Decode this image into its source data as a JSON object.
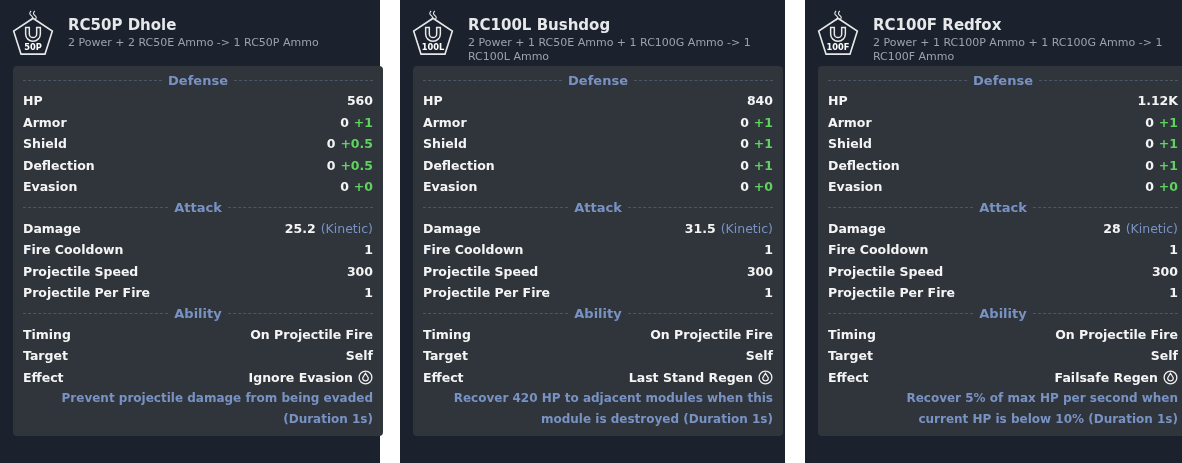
{
  "panels": [
    {
      "badge": "50P",
      "title": "RC50P Dhole",
      "recipe": "2 Power + 2 RC50E Ammo -> 1 RC50P Ammo",
      "sections": [
        {
          "heading": "Defense",
          "rows": [
            {
              "kind": "stat",
              "label": "HP",
              "value": "560"
            },
            {
              "kind": "stat",
              "label": "Armor",
              "value": "0",
              "bonus": "+1"
            },
            {
              "kind": "stat",
              "label": "Shield",
              "value": "0",
              "bonus": "+0.5"
            },
            {
              "kind": "stat",
              "label": "Deflection",
              "value": "0",
              "bonus": "+0.5"
            },
            {
              "kind": "stat",
              "label": "Evasion",
              "value": "0",
              "bonus": "+0"
            }
          ]
        },
        {
          "heading": "Attack",
          "rows": [
            {
              "kind": "stat",
              "label": "Damage",
              "value": "25.2",
              "note": "(Kinetic)"
            },
            {
              "kind": "stat",
              "label": "Fire Cooldown",
              "value": "1"
            },
            {
              "kind": "stat",
              "label": "Projectile Speed",
              "value": "300"
            },
            {
              "kind": "stat",
              "label": "Projectile Per Fire",
              "value": "1"
            }
          ]
        },
        {
          "heading": "Ability",
          "rows": [
            {
              "kind": "stat",
              "label": "Timing",
              "value": "On Projectile Fire"
            },
            {
              "kind": "stat",
              "label": "Target",
              "value": "Self"
            },
            {
              "kind": "effect",
              "label": "Effect",
              "value": "Ignore Evasion"
            }
          ],
          "description": "Prevent projectile damage from being evaded (Duration 1s)"
        }
      ]
    },
    {
      "badge": "100L",
      "title": "RC100L Bushdog",
      "recipe": "2 Power + 1 RC50E Ammo + 1 RC100G Ammo -> 1 RC100L Ammo",
      "sections": [
        {
          "heading": "Defense",
          "rows": [
            {
              "kind": "stat",
              "label": "HP",
              "value": "840"
            },
            {
              "kind": "stat",
              "label": "Armor",
              "value": "0",
              "bonus": "+1"
            },
            {
              "kind": "stat",
              "label": "Shield",
              "value": "0",
              "bonus": "+1"
            },
            {
              "kind": "stat",
              "label": "Deflection",
              "value": "0",
              "bonus": "+1"
            },
            {
              "kind": "stat",
              "label": "Evasion",
              "value": "0",
              "bonus": "+0"
            }
          ]
        },
        {
          "heading": "Attack",
          "rows": [
            {
              "kind": "stat",
              "label": "Damage",
              "value": "31.5",
              "note": "(Kinetic)"
            },
            {
              "kind": "stat",
              "label": "Fire Cooldown",
              "value": "1"
            },
            {
              "kind": "stat",
              "label": "Projectile Speed",
              "value": "300"
            },
            {
              "kind": "stat",
              "label": "Projectile Per Fire",
              "value": "1"
            }
          ]
        },
        {
          "heading": "Ability",
          "rows": [
            {
              "kind": "stat",
              "label": "Timing",
              "value": "On Projectile Fire"
            },
            {
              "kind": "stat",
              "label": "Target",
              "value": "Self"
            },
            {
              "kind": "effect",
              "label": "Effect",
              "value": "Last Stand Regen"
            }
          ],
          "description": "Recover 420 HP to adjacent modules when this module is destroyed (Duration 1s)"
        }
      ]
    },
    {
      "badge": "100F",
      "title": "RC100F Redfox",
      "recipe": "2 Power + 1 RC100P Ammo + 1 RC100G Ammo -> 1 RC100F Ammo",
      "sections": [
        {
          "heading": "Defense",
          "rows": [
            {
              "kind": "stat",
              "label": "HP",
              "value": "1.12K"
            },
            {
              "kind": "stat",
              "label": "Armor",
              "value": "0",
              "bonus": "+1"
            },
            {
              "kind": "stat",
              "label": "Shield",
              "value": "0",
              "bonus": "+1"
            },
            {
              "kind": "stat",
              "label": "Deflection",
              "value": "0",
              "bonus": "+1"
            },
            {
              "kind": "stat",
              "label": "Evasion",
              "value": "0",
              "bonus": "+0"
            }
          ]
        },
        {
          "heading": "Attack",
          "rows": [
            {
              "kind": "stat",
              "label": "Damage",
              "value": "28",
              "note": "(Kinetic)"
            },
            {
              "kind": "stat",
              "label": "Fire Cooldown",
              "value": "1"
            },
            {
              "kind": "stat",
              "label": "Projectile Speed",
              "value": "300"
            },
            {
              "kind": "stat",
              "label": "Projectile Per Fire",
              "value": "1"
            }
          ]
        },
        {
          "heading": "Ability",
          "rows": [
            {
              "kind": "stat",
              "label": "Timing",
              "value": "On Projectile Fire"
            },
            {
              "kind": "stat",
              "label": "Target",
              "value": "Self"
            },
            {
              "kind": "effect",
              "label": "Effect",
              "value": "Failsafe Regen"
            }
          ],
          "description": "Recover 5% of max HP per second when current HP is below 10% (Duration 1s)"
        }
      ]
    }
  ]
}
